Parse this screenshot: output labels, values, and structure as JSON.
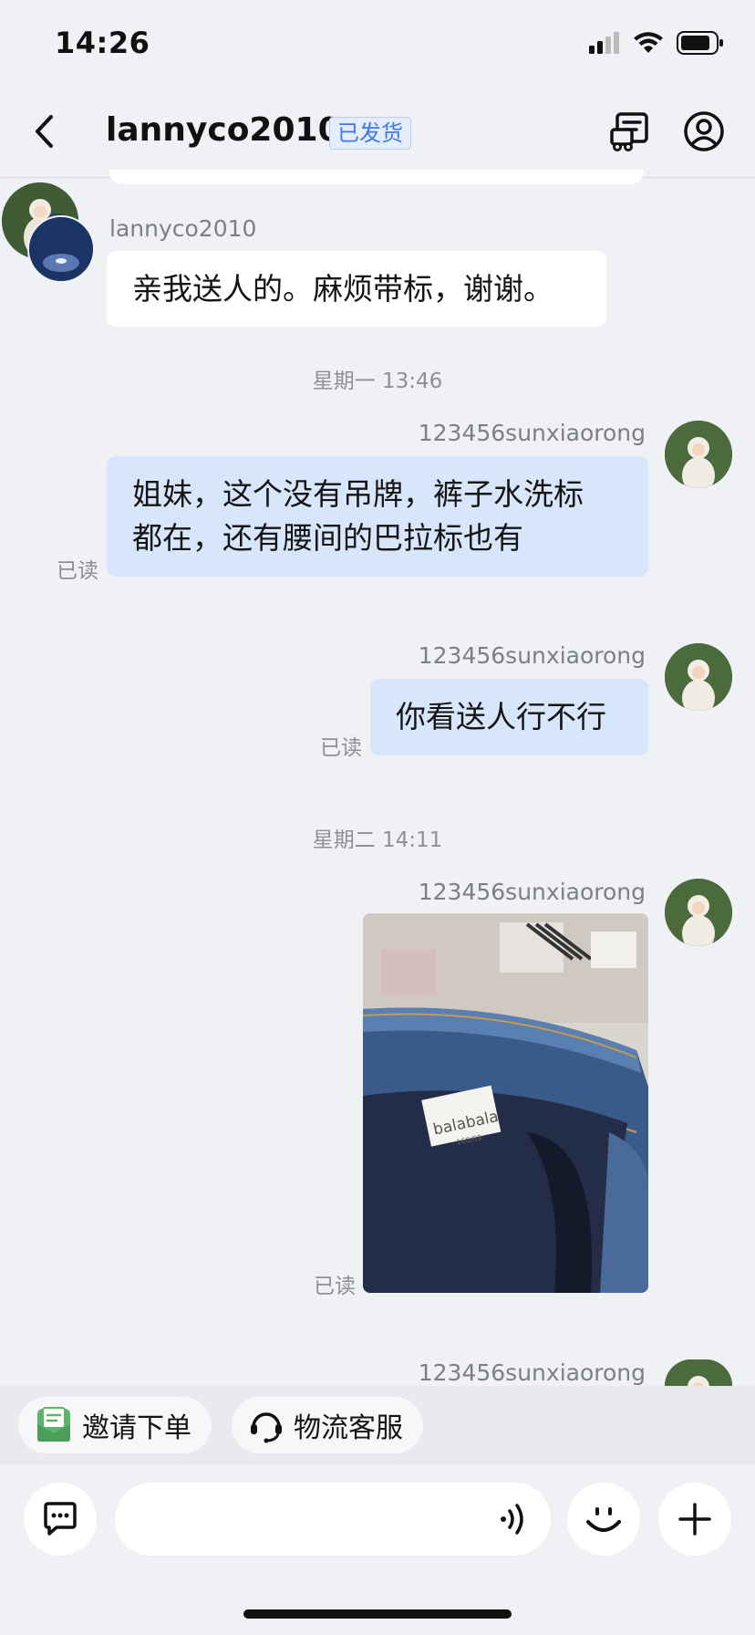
{
  "status_bar": {
    "time": "14:26"
  },
  "nav": {
    "title": "lannyco2010",
    "badge": "已发货",
    "back_icon": "chevron-left-icon",
    "right_icons": [
      "order-document-icon",
      "user-profile-icon"
    ]
  },
  "messages": [
    {
      "type": "incoming",
      "sender": "lannyco2010",
      "text": "亲我送人的。麻烦带标，谢谢。"
    },
    {
      "type": "timestamp",
      "text": "星期一 13:46"
    },
    {
      "type": "outgoing",
      "sender": "123456sunxiaorong",
      "text_lines": [
        "姐妹，这个没有吊牌，裤子水洗标",
        "都在，还有腰间的巴拉标也有"
      ],
      "status": "已读"
    },
    {
      "type": "outgoing",
      "sender": "123456sunxiaorong",
      "text": "你看送人行不行",
      "status": "已读"
    },
    {
      "type": "timestamp",
      "text": "星期二 14:11"
    },
    {
      "type": "outgoing_image",
      "sender": "123456sunxiaorong",
      "status": "已读",
      "image_label": {
        "brand": "balabala",
        "size": "160/69"
      }
    },
    {
      "type": "outgoing_partial",
      "sender": "123456sunxiaorong"
    }
  ],
  "quick_actions": [
    {
      "label": "邀请下单",
      "icon": "invite-order-icon"
    },
    {
      "label": "物流客服",
      "icon": "logistics-service-icon"
    }
  ],
  "input_bar": {
    "left_icon": "chat-bubble-icon",
    "voice_icon": "voice-wave-icon",
    "emoji_icon": "smiley-icon",
    "add_icon": "plus-icon"
  },
  "colors": {
    "background": "#f0f1f5",
    "outgoing_bubble": "#d8e6fb",
    "incoming_bubble": "#ffffff",
    "badge_text": "#3e79e8",
    "invite_icon": "#5db36a"
  }
}
